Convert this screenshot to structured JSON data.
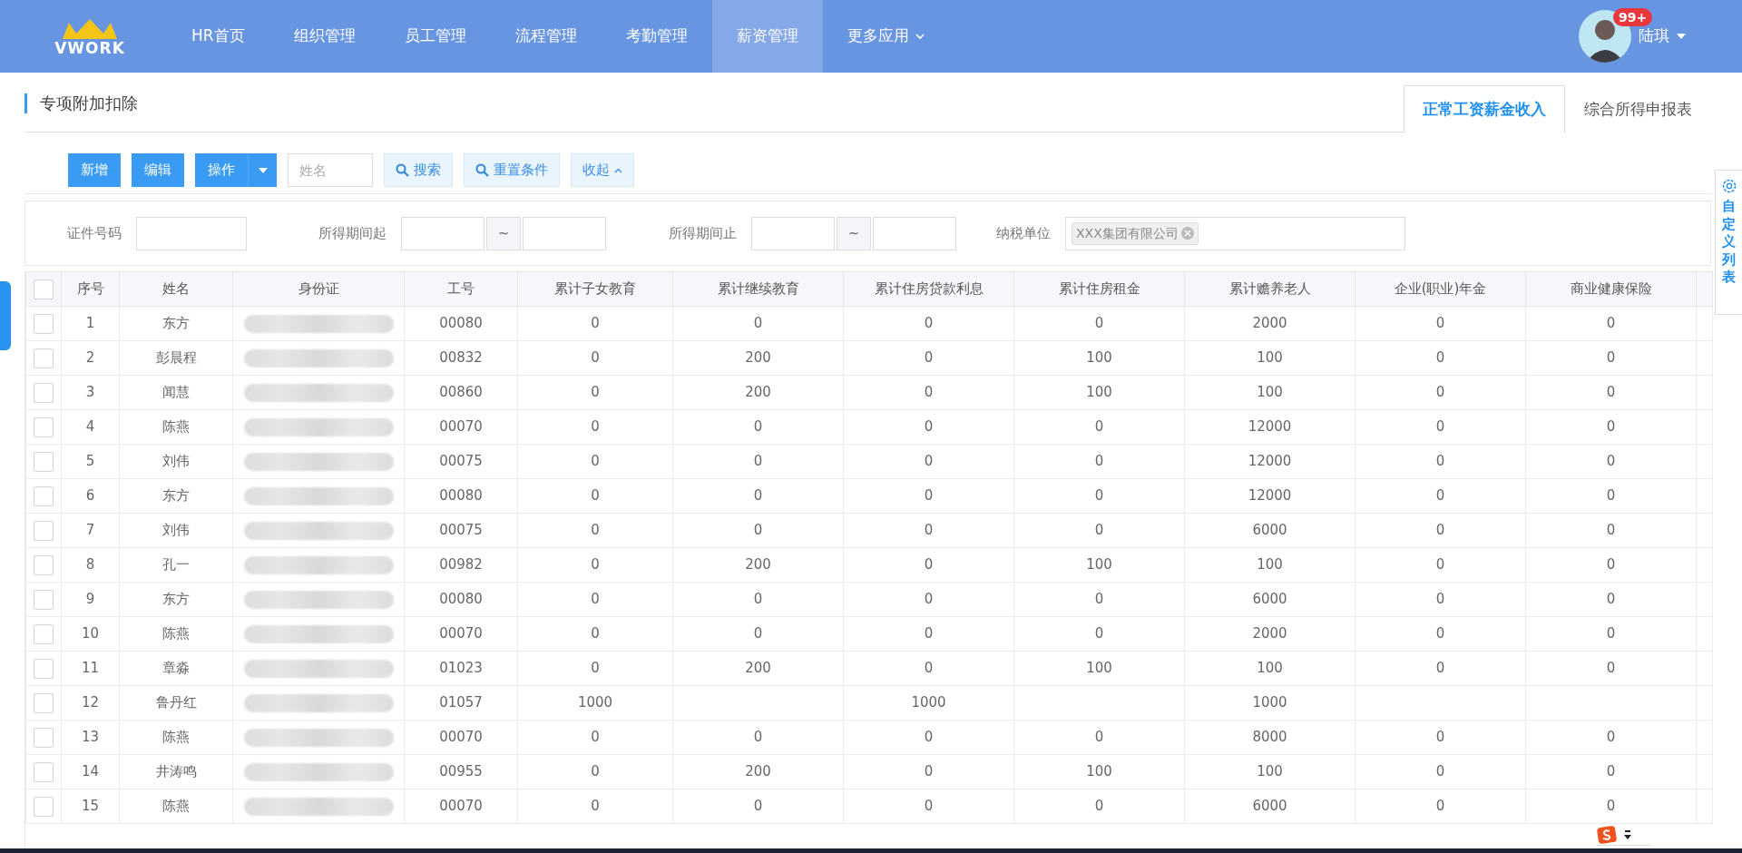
{
  "logo": {
    "text": "VWORK"
  },
  "nav": [
    {
      "label": "HR首页",
      "selected": false
    },
    {
      "label": "组织管理",
      "selected": false
    },
    {
      "label": "员工管理",
      "selected": false
    },
    {
      "label": "流程管理",
      "selected": false
    },
    {
      "label": "考勤管理",
      "selected": false
    },
    {
      "label": "薪资管理",
      "selected": true
    },
    {
      "label": "更多应用",
      "selected": false,
      "dropdown": true
    }
  ],
  "user": {
    "name": "陆琪",
    "badge": "99+"
  },
  "page_title": "专项附加扣除",
  "tabs": [
    {
      "label": "正常工资薪金收入",
      "selected": true
    },
    {
      "label": "综合所得申报表",
      "selected": false
    }
  ],
  "toolbar": {
    "buttons": [
      {
        "label": "新增",
        "kind": "primary"
      },
      {
        "label": "编辑",
        "kind": "primary"
      },
      {
        "label": "操作",
        "kind": "split"
      }
    ],
    "search": {
      "placeholder": "姓名"
    },
    "actions": [
      {
        "label": "搜索",
        "kind": "search"
      },
      {
        "label": "重置条件",
        "kind": "search"
      },
      {
        "label": "收起",
        "kind": "collapse"
      }
    ]
  },
  "filters": [
    {
      "label": "证件号码",
      "kind": "single"
    },
    {
      "label": "所得期间起",
      "kind": "range",
      "separator": "~"
    },
    {
      "label": "所得期间止",
      "kind": "range",
      "separator": "~"
    },
    {
      "label": "纳税单位",
      "kind": "tags",
      "tags": [
        "XXX集团有限公司"
      ]
    }
  ],
  "side_tab": {
    "label": "自定义列表"
  },
  "select_all": {
    "checked": false
  },
  "table": {
    "columns": [
      "序号",
      "姓名",
      "身份证",
      "工号",
      "累计子女教育",
      "累计继续教育",
      "累计住房贷款利息",
      "累计住房租金",
      "累计赡养老人",
      "企业(职业)年金",
      "商业健康保险"
    ],
    "rows": [
      {
        "checked": false,
        "no": "1",
        "name": "东方",
        "emp_no": "00080",
        "values": [
          "0",
          "0",
          "0",
          "0",
          "2000",
          "0",
          "0"
        ]
      },
      {
        "checked": false,
        "no": "2",
        "name": "彭晨程",
        "emp_no": "00832",
        "values": [
          "0",
          "200",
          "0",
          "100",
          "100",
          "0",
          "0"
        ]
      },
      {
        "checked": false,
        "no": "3",
        "name": "闻慧",
        "emp_no": "00860",
        "values": [
          "0",
          "200",
          "0",
          "100",
          "100",
          "0",
          "0"
        ]
      },
      {
        "checked": false,
        "no": "4",
        "name": "陈燕",
        "emp_no": "00070",
        "values": [
          "0",
          "0",
          "0",
          "0",
          "12000",
          "0",
          "0"
        ]
      },
      {
        "checked": false,
        "no": "5",
        "name": "刘伟",
        "emp_no": "00075",
        "values": [
          "0",
          "0",
          "0",
          "0",
          "12000",
          "0",
          "0"
        ]
      },
      {
        "checked": false,
        "no": "6",
        "name": "东方",
        "emp_no": "00080",
        "values": [
          "0",
          "0",
          "0",
          "0",
          "12000",
          "0",
          "0"
        ]
      },
      {
        "checked": false,
        "no": "7",
        "name": "刘伟",
        "emp_no": "00075",
        "values": [
          "0",
          "0",
          "0",
          "0",
          "6000",
          "0",
          "0"
        ]
      },
      {
        "checked": false,
        "no": "8",
        "name": "孔一",
        "emp_no": "00982",
        "values": [
          "0",
          "200",
          "0",
          "100",
          "100",
          "0",
          "0"
        ]
      },
      {
        "checked": false,
        "no": "9",
        "name": "东方",
        "emp_no": "00080",
        "values": [
          "0",
          "0",
          "0",
          "0",
          "6000",
          "0",
          "0"
        ]
      },
      {
        "checked": false,
        "no": "10",
        "name": "陈燕",
        "emp_no": "00070",
        "values": [
          "0",
          "0",
          "0",
          "0",
          "2000",
          "0",
          "0"
        ]
      },
      {
        "checked": false,
        "no": "11",
        "name": "章淼",
        "emp_no": "01023",
        "values": [
          "0",
          "200",
          "0",
          "100",
          "100",
          "0",
          "0"
        ]
      },
      {
        "checked": false,
        "no": "12",
        "name": "鲁丹红",
        "emp_no": "01057",
        "values": {
          "children_education": "1000",
          "mortgage_interest": "1000",
          "elderly_support": "1000"
        }
      },
      {
        "checked": false,
        "no": "13",
        "name": "陈燕",
        "emp_no": "00070",
        "values": [
          "0",
          "0",
          "0",
          "0",
          "8000",
          "0",
          "0"
        ]
      },
      {
        "checked": false,
        "no": "14",
        "name": "井涛鸣",
        "emp_no": "00955",
        "values": [
          "0",
          "200",
          "0",
          "100",
          "100",
          "0",
          "0"
        ]
      },
      {
        "checked": false,
        "no": "15",
        "name": "陈燕",
        "emp_no": "00070",
        "values": [
          "0",
          "0",
          "0",
          "0",
          "6000",
          "0",
          "0"
        ]
      }
    ]
  }
}
